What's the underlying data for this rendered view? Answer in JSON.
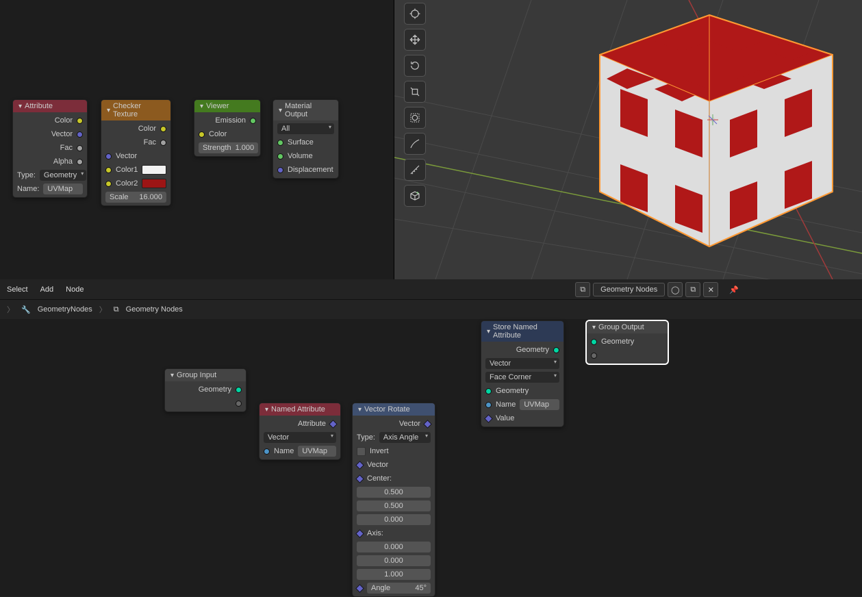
{
  "shader": {
    "attribute": {
      "title": "Attribute",
      "outputs": [
        "Color",
        "Vector",
        "Fac",
        "Alpha"
      ],
      "type_label": "Type:",
      "type_value": "Geometry",
      "name_label": "Name:",
      "name_value": "UVMap"
    },
    "checker": {
      "title": "Checker Texture",
      "outputs": [
        "Color",
        "Fac"
      ],
      "inputs": [
        "Vector",
        "Color1",
        "Color2"
      ],
      "scale_label": "Scale",
      "scale_value": "16.000",
      "color1": "#f2f2f2",
      "color2": "#9c1515"
    },
    "viewer": {
      "title": "Viewer",
      "emission": "Emission",
      "color": "Color",
      "strength_label": "Strength",
      "strength_value": "1.000"
    },
    "mat_out": {
      "title": "Material Output",
      "target": "All",
      "inputs": [
        "Surface",
        "Volume",
        "Displacement"
      ]
    }
  },
  "viewport": {
    "gizmo_tools": [
      "cursor",
      "move",
      "rotate",
      "scale",
      "transform",
      "annotate",
      "measure",
      "add-cube"
    ]
  },
  "geom_header": {
    "menus": [
      "Select",
      "Add",
      "Node"
    ],
    "tree_name": "Geometry Nodes"
  },
  "breadcrumb": {
    "a": "GeometryNodes",
    "b": "Geometry Nodes"
  },
  "geom": {
    "group_input": {
      "title": "Group Input",
      "out": "Geometry"
    },
    "named_attr": {
      "title": "Named Attribute",
      "attribute": "Attribute",
      "type": "Vector",
      "name_label": "Name",
      "name_value": "UVMap"
    },
    "vec_rotate": {
      "title": "Vector Rotate",
      "vector": "Vector",
      "type_label": "Type:",
      "type_value": "Axis Angle",
      "invert": "Invert",
      "vec_in": "Vector",
      "center": "Center:",
      "cx": "0.500",
      "cy": "0.500",
      "cz": "0.000",
      "axis": "Axis:",
      "ax": "0.000",
      "ay": "0.000",
      "az": "1.000",
      "angle_label": "Angle",
      "angle_value": "45°"
    },
    "store": {
      "title": "Store Named Attribute",
      "geometry": "Geometry",
      "type": "Vector",
      "domain": "Face Corner",
      "geo_in": "Geometry",
      "name_label": "Name",
      "name_value": "UVMap",
      "value": "Value"
    },
    "group_output": {
      "title": "Group Output",
      "in": "Geometry"
    }
  }
}
